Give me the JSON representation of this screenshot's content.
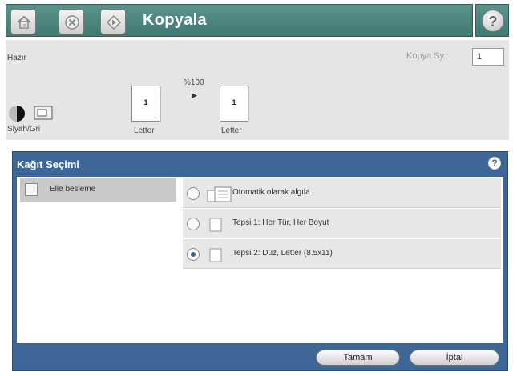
{
  "header": {
    "title": "Kopyala",
    "icons": [
      "home-icon",
      "stop-icon",
      "start-icon",
      "help-icon"
    ]
  },
  "status": {
    "text": "Hazır",
    "copies_label": "Kopya Sy.:",
    "copies_value": "1",
    "scale": "%100",
    "color_mode": "Siyah/Gri",
    "original": {
      "count": "1",
      "size": "Letter"
    },
    "output": {
      "count": "1",
      "size": "Letter"
    }
  },
  "dialog": {
    "title": "Kağıt Seçimi",
    "help": "?",
    "manual_feed": "Elle besleme",
    "options": [
      {
        "label": "Otomatik olarak algıla",
        "selected": false,
        "icon": "auto-paper-icon"
      },
      {
        "label": "Tepsi 1: Her Tür, Her Boyut",
        "selected": false,
        "icon": "paper-icon"
      },
      {
        "label": "Tepsi 2: Düz, Letter (8.5x11)",
        "selected": true,
        "icon": "paper-icon"
      }
    ],
    "ok_label": "Tamam",
    "cancel_label": "İptal"
  },
  "colors": {
    "header_teal": "#4a867e",
    "dialog_blue": "#3d6796",
    "status_gray": "#e5e5e5"
  }
}
